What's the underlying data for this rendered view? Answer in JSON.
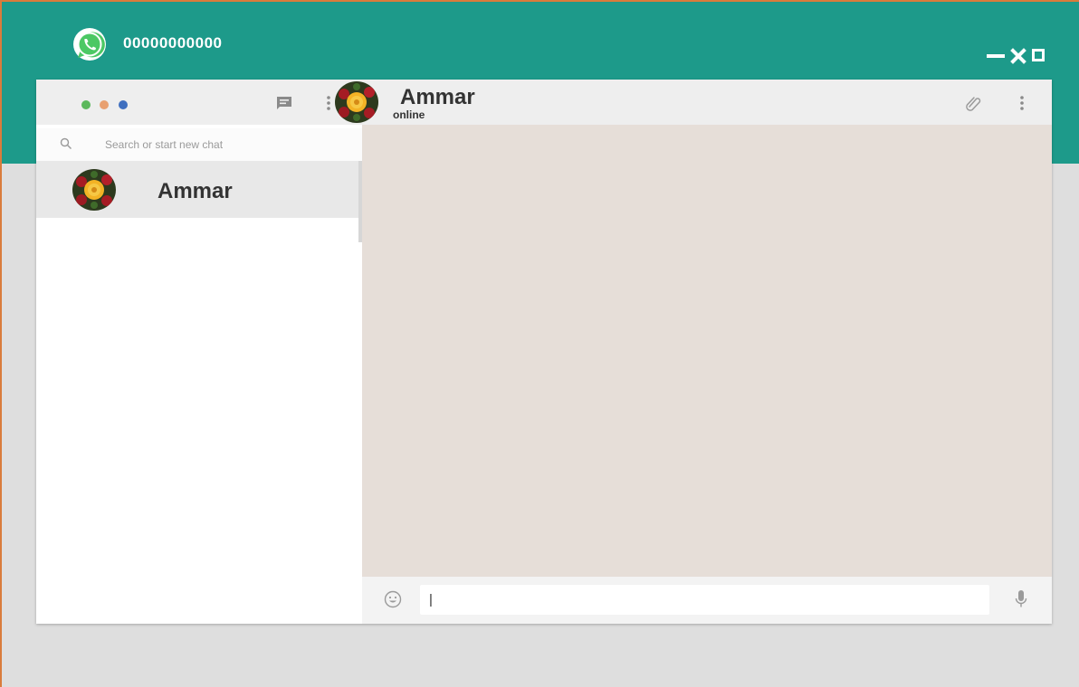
{
  "app": {
    "phone_number": "00000000000",
    "logo_icon": "whatsapp-icon"
  },
  "window_controls": {
    "minimize_icon": "minimize-icon",
    "close_icon": "close-icon",
    "maximize_icon": "maximize-icon"
  },
  "sidebar": {
    "header_dots": [
      {
        "color": "#5cb85c"
      },
      {
        "color": "#e8a070"
      },
      {
        "color": "#3f6fbf"
      }
    ],
    "new_chat_icon": "chat-icon",
    "menu_icon": "more-vert-icon",
    "search": {
      "placeholder": "Search or start new chat",
      "icon": "search-icon"
    },
    "chats": [
      {
        "name": "Ammar",
        "avatar": "flower-avatar",
        "selected": true
      }
    ]
  },
  "conversation": {
    "contact_name": "Ammar",
    "status": "online",
    "attach_icon": "paperclip-icon",
    "menu_icon": "more-vert-icon"
  },
  "composer": {
    "emoji_icon": "emoji-icon",
    "value": "|",
    "mic_icon": "mic-icon"
  },
  "colors": {
    "top_band": "#1d9a8a",
    "frame_border": "#d97c3c",
    "chat_background": "#e6ded8"
  }
}
